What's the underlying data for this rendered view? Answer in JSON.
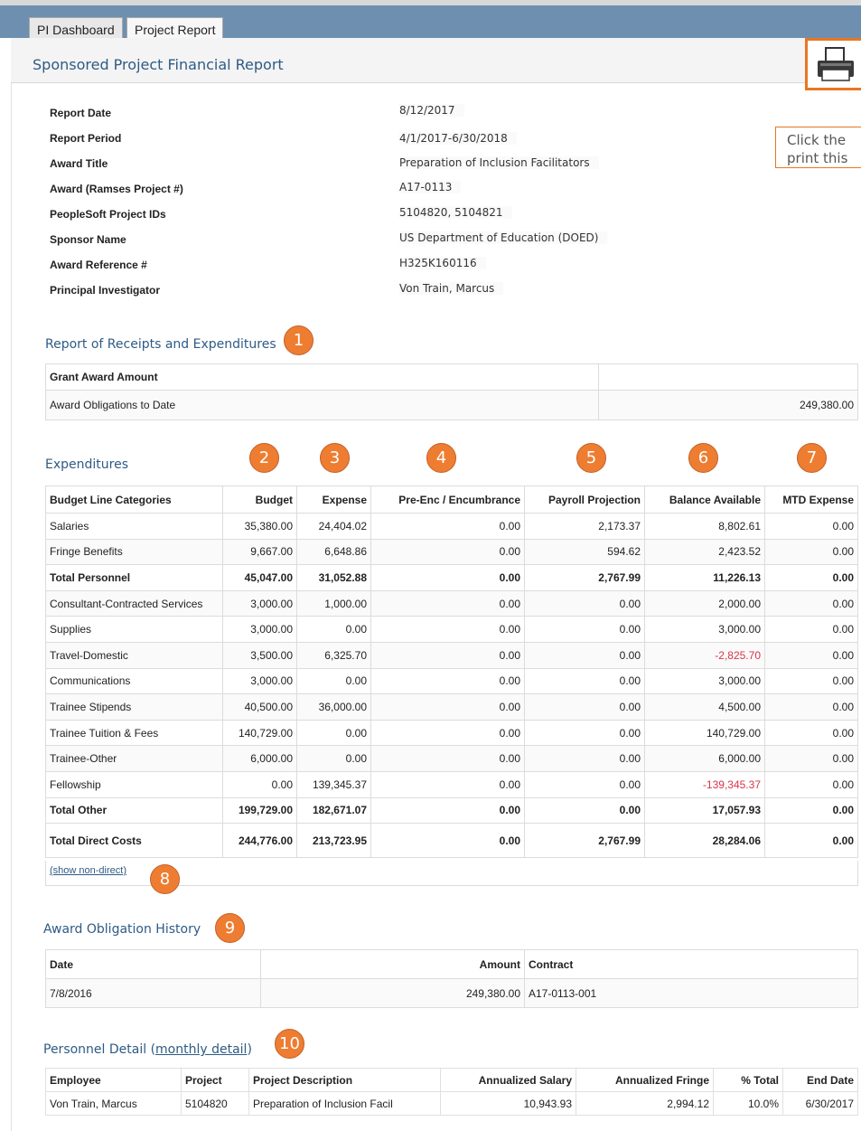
{
  "tabs": [
    "PI Dashboard",
    "Project Report"
  ],
  "page_title": "Sponsored Project Financial Report",
  "print_icon": "printer-icon",
  "tooltip": "Click the print this",
  "info": [
    {
      "label": "Report Date",
      "value": "8/12/2017"
    },
    {
      "label": "Report Period",
      "value": "4/1/2017-6/30/2018"
    },
    {
      "label": "Award Title",
      "value": "Preparation of Inclusion Facilitators"
    },
    {
      "label": "Award (Ramses Project #)",
      "value": "A17-0113"
    },
    {
      "label": "PeopleSoft Project IDs",
      "value": "5104820, 5104821"
    },
    {
      "label": "Sponsor Name",
      "value": "US Department of Education (DOED)"
    },
    {
      "label": "Award Reference #",
      "value": "H325K160116"
    },
    {
      "label": "Principal Investigator",
      "value": "Von Train, Marcus"
    }
  ],
  "receipts": {
    "title": "Report of Receipts and Expenditures",
    "header": "Grant Award Amount",
    "row_label": "Award Obligations to Date",
    "row_value": "249,380.00"
  },
  "expenditures": {
    "title": "Expenditures",
    "columns": [
      "Budget Line Categories",
      "Budget",
      "Expense",
      "Pre-Enc / Encumbrance",
      "Payroll Projection",
      "Balance Available",
      "MTD Expense"
    ],
    "rows": [
      [
        "Salaries",
        "35,380.00",
        "24,404.02",
        "0.00",
        "2,173.37",
        "8,802.61",
        "0.00"
      ],
      [
        "Fringe Benefits",
        "9,667.00",
        "6,648.86",
        "0.00",
        "594.62",
        "2,423.52",
        "0.00"
      ],
      [
        "Total Personnel",
        "45,047.00",
        "31,052.88",
        "0.00",
        "2,767.99",
        "11,226.13",
        "0.00"
      ],
      [
        "Consultant-Contracted Services",
        "3,000.00",
        "1,000.00",
        "0.00",
        "0.00",
        "2,000.00",
        "0.00"
      ],
      [
        "Supplies",
        "3,000.00",
        "0.00",
        "0.00",
        "0.00",
        "3,000.00",
        "0.00"
      ],
      [
        "Travel-Domestic",
        "3,500.00",
        "6,325.70",
        "0.00",
        "0.00",
        "-2,825.70",
        "0.00"
      ],
      [
        "Communications",
        "3,000.00",
        "0.00",
        "0.00",
        "0.00",
        "3,000.00",
        "0.00"
      ],
      [
        "Trainee Stipends",
        "40,500.00",
        "36,000.00",
        "0.00",
        "0.00",
        "4,500.00",
        "0.00"
      ],
      [
        "Trainee Tuition & Fees",
        "140,729.00",
        "0.00",
        "0.00",
        "0.00",
        "140,729.00",
        "0.00"
      ],
      [
        "Trainee-Other",
        "6,000.00",
        "0.00",
        "0.00",
        "0.00",
        "6,000.00",
        "0.00"
      ],
      [
        "Fellowship",
        "0.00",
        "139,345.37",
        "0.00",
        "0.00",
        "-139,345.37",
        "0.00"
      ],
      [
        "Total Other",
        "199,729.00",
        "182,671.07",
        "0.00",
        "0.00",
        "17,057.93",
        "0.00"
      ],
      [
        "Total Direct Costs",
        "244,776.00",
        "213,723.95",
        "0.00",
        "2,767.99",
        "28,284.06",
        "0.00"
      ]
    ],
    "show_non_direct": "(show non-direct)"
  },
  "history": {
    "title": "Award Obligation History",
    "columns": [
      "Date",
      "Amount",
      "Contract"
    ],
    "rows": [
      [
        "7/8/2016",
        "249,380.00",
        "A17-0113-001"
      ]
    ]
  },
  "personnel": {
    "title_prefix": "Personnel Detail (",
    "title_link": "monthly detail",
    "title_suffix": ")",
    "columns": [
      "Employee",
      "Project",
      "Project Description",
      "Annualized Salary",
      "Annualized Fringe",
      "% Total",
      "End Date"
    ],
    "rows": [
      [
        "Von Train, Marcus",
        "5104820",
        "Preparation of Inclusion Facil",
        "10,943.93",
        "2,994.12",
        "10.0%",
        "6/30/2017"
      ]
    ]
  },
  "badges": [
    "1",
    "2",
    "3",
    "4",
    "5",
    "6",
    "7",
    "8",
    "9",
    "10"
  ]
}
